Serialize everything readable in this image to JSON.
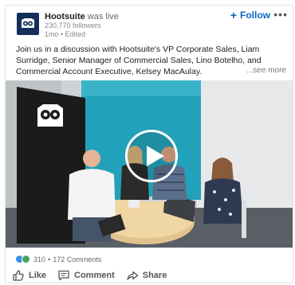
{
  "post": {
    "author_name": "Hootsuite",
    "author_verb": "was live",
    "followers": "230,770 followers",
    "meta": "1mo • Edited",
    "follow_label": "Follow",
    "more_label": "•••",
    "text": "Join us in a discussion with Hootsuite's VP Corporate Sales, Liam Surridge, Senior Manager of Commercial Sales, Lino Botelho, and Commercial Account Executive, Kelsey MacAulay.",
    "see_more": "...see more"
  },
  "video": {
    "play_icon": "play-icon",
    "has_play_button": true
  },
  "social": {
    "reaction_count": "310",
    "separator": "•",
    "comments": "172 Comments",
    "reaction_icons": [
      "like-reaction-icon",
      "celebrate-reaction-icon"
    ]
  },
  "actions": {
    "like": "Like",
    "comment": "Comment",
    "share": "Share"
  },
  "colors": {
    "accent": "#0a66c2",
    "logo_bg": "#143059",
    "like_blue": "#378fe9",
    "celebrate_green": "#44a35a"
  }
}
